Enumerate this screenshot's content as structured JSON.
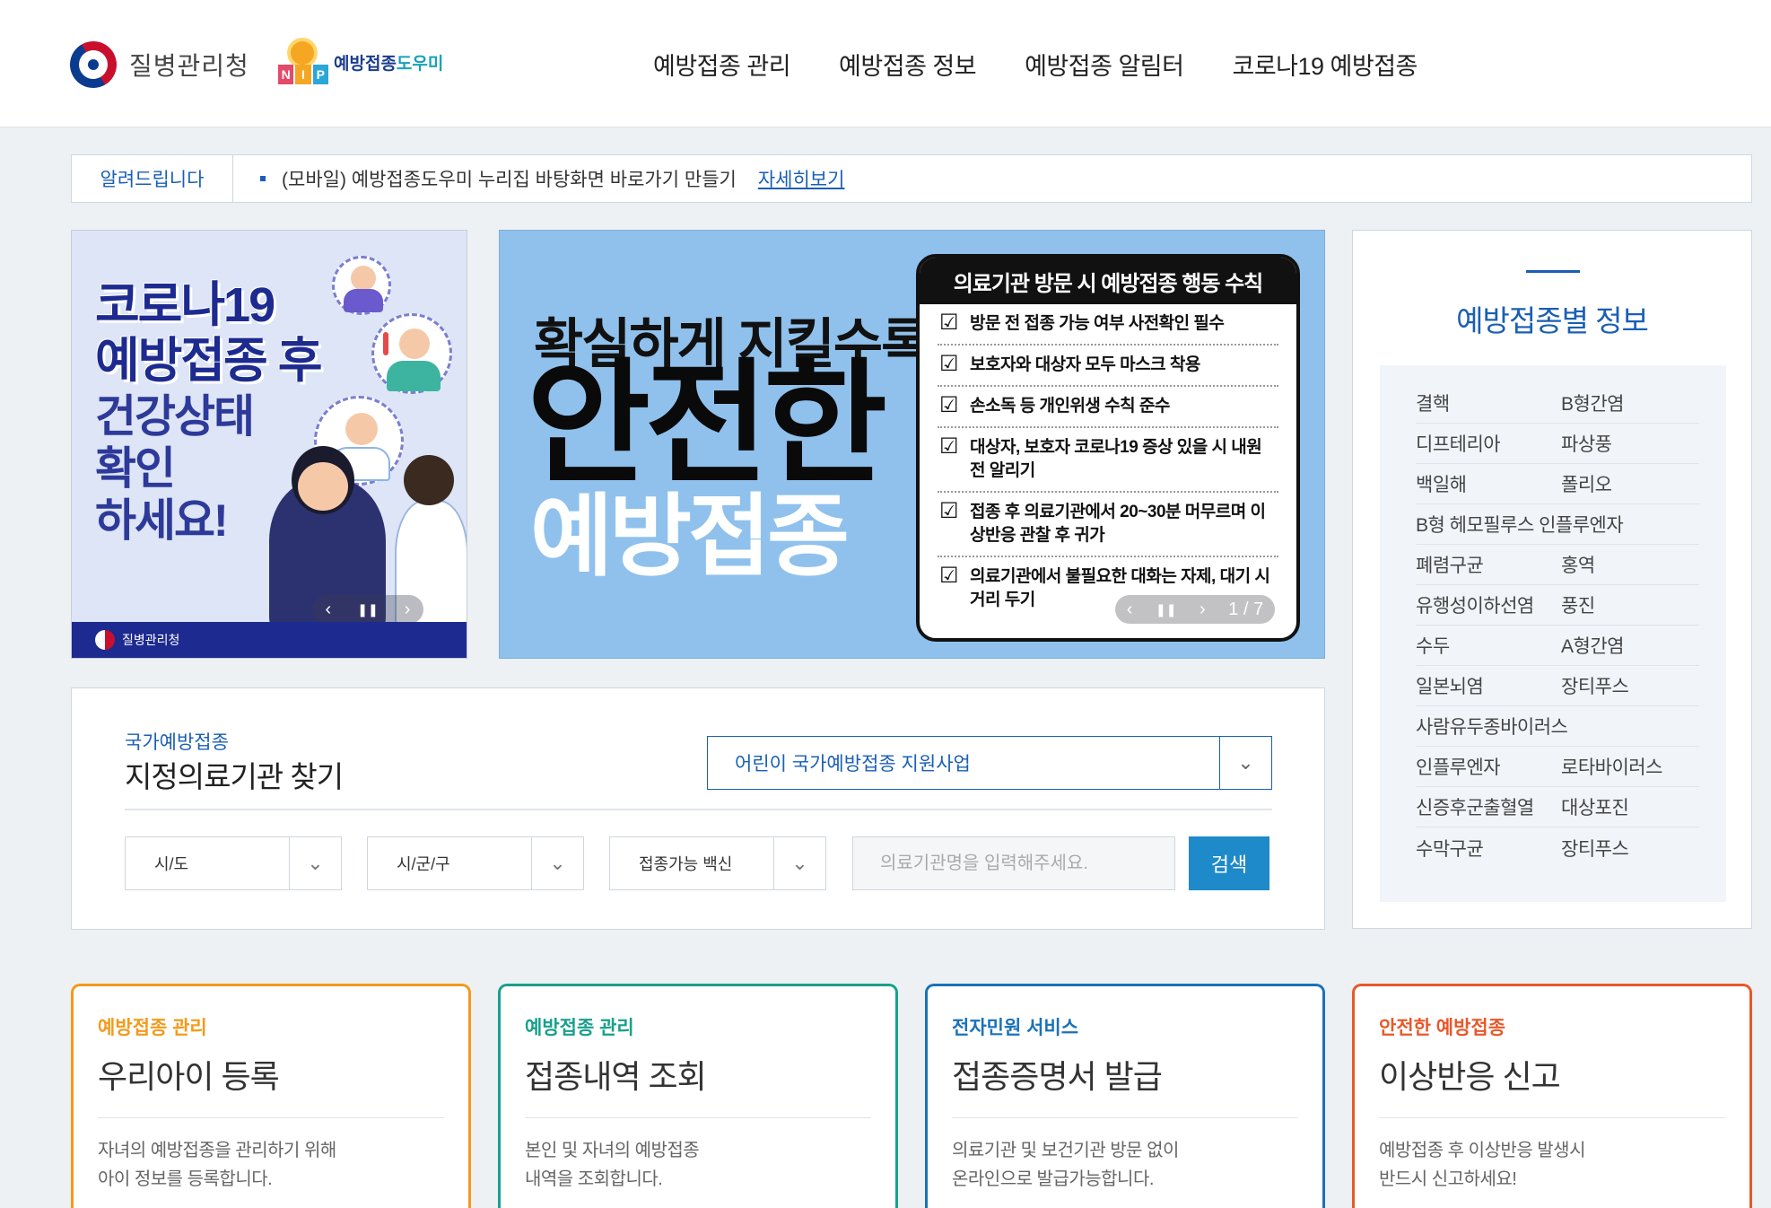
{
  "header": {
    "kdca_name": "질병관리청",
    "nip_label": "NIP",
    "nip_name_a": "예방접종",
    "nip_name_b": "도우미",
    "nav": [
      "예방접종 관리",
      "예방접종 정보",
      "예방접종 알림터",
      "코로나19 예방접종"
    ]
  },
  "notice": {
    "tag": "알려드립니다",
    "text": "(모바일) 예방접종도우미 누리집 바탕화면 바로가기 만들기",
    "link": "자세히보기"
  },
  "banner_left": {
    "title_1": "코로나19",
    "title_2": "예방접종 후",
    "sub_1": "건강상태",
    "sub_2": "확인",
    "sub_3": "하세요!",
    "footer": "질병관리청"
  },
  "banner_center": {
    "line1": "확실하게 지킬수록",
    "line2": "안전한",
    "line3": "예방접종",
    "card_title": "의료기관 방문 시 예방접종 행동 수칙",
    "items": [
      "방문 전 접종 가능 여부 사전확인 필수",
      "보호자와 대상자 모두 마스크 착용",
      "손소독 등 개인위생 수칙 준수",
      "대상자, 보호자 코로나19 증상 있을 시 내원 전 알리기",
      "접종 후 의료기관에서 20~30분 머무르며 이상반응 관찰 후 귀가",
      "의료기관에서 불필요한 대화는 자제, 대기 시 거리 두기"
    ],
    "pager": "1 / 7"
  },
  "info_panel": {
    "title": "예방접종별 정보",
    "rows": [
      [
        "결핵",
        "B형간염"
      ],
      [
        "디프테리아",
        "파상풍"
      ],
      [
        "백일해",
        "폴리오"
      ],
      [
        "B형 헤모필루스 인플루엔자",
        ""
      ],
      [
        "폐렴구균",
        "홍역"
      ],
      [
        "유행성이하선염",
        "풍진"
      ],
      [
        "수두",
        "A형간염"
      ],
      [
        "일본뇌염",
        "장티푸스"
      ],
      [
        "사람유두종바이러스",
        ""
      ],
      [
        "인플루엔자",
        "로타바이러스"
      ],
      [
        "신증후군출혈열",
        "대상포진"
      ],
      [
        "수막구균",
        "장티푸스"
      ]
    ]
  },
  "search": {
    "sub": "국가예방접종",
    "title": "지정의료기관 찾기",
    "program_select": "어린이 국가예방접종 지원사업",
    "sido": "시/도",
    "sigungu": "시/군/구",
    "vaccine": "접종가능 백신",
    "placeholder": "의료기관명을 입력해주세요.",
    "button": "검색"
  },
  "cards": [
    {
      "sub": "예방접종 관리",
      "title": "우리아이 등록",
      "desc": "자녀의 예방접종을 관리하기 위해\n아이 정보를 등록합니다.",
      "color": "#f39a1b"
    },
    {
      "sub": "예방접종 관리",
      "title": "접종내역 조회",
      "desc": "본인 및 자녀의 예방접종\n내역을 조회합니다.",
      "color": "#18a08c"
    },
    {
      "sub": "전자민원 서비스",
      "title": "접종증명서 발급",
      "desc": "의료기관 및 보건기관 방문 없이\n온라인으로 발급가능합니다.",
      "color": "#1a72b8"
    },
    {
      "sub": "안전한 예방접종",
      "title": "이상반응 신고",
      "desc": "예방접종 후 이상반응 발생시\n반드시 신고하세요!",
      "color": "#e8582a"
    }
  ]
}
